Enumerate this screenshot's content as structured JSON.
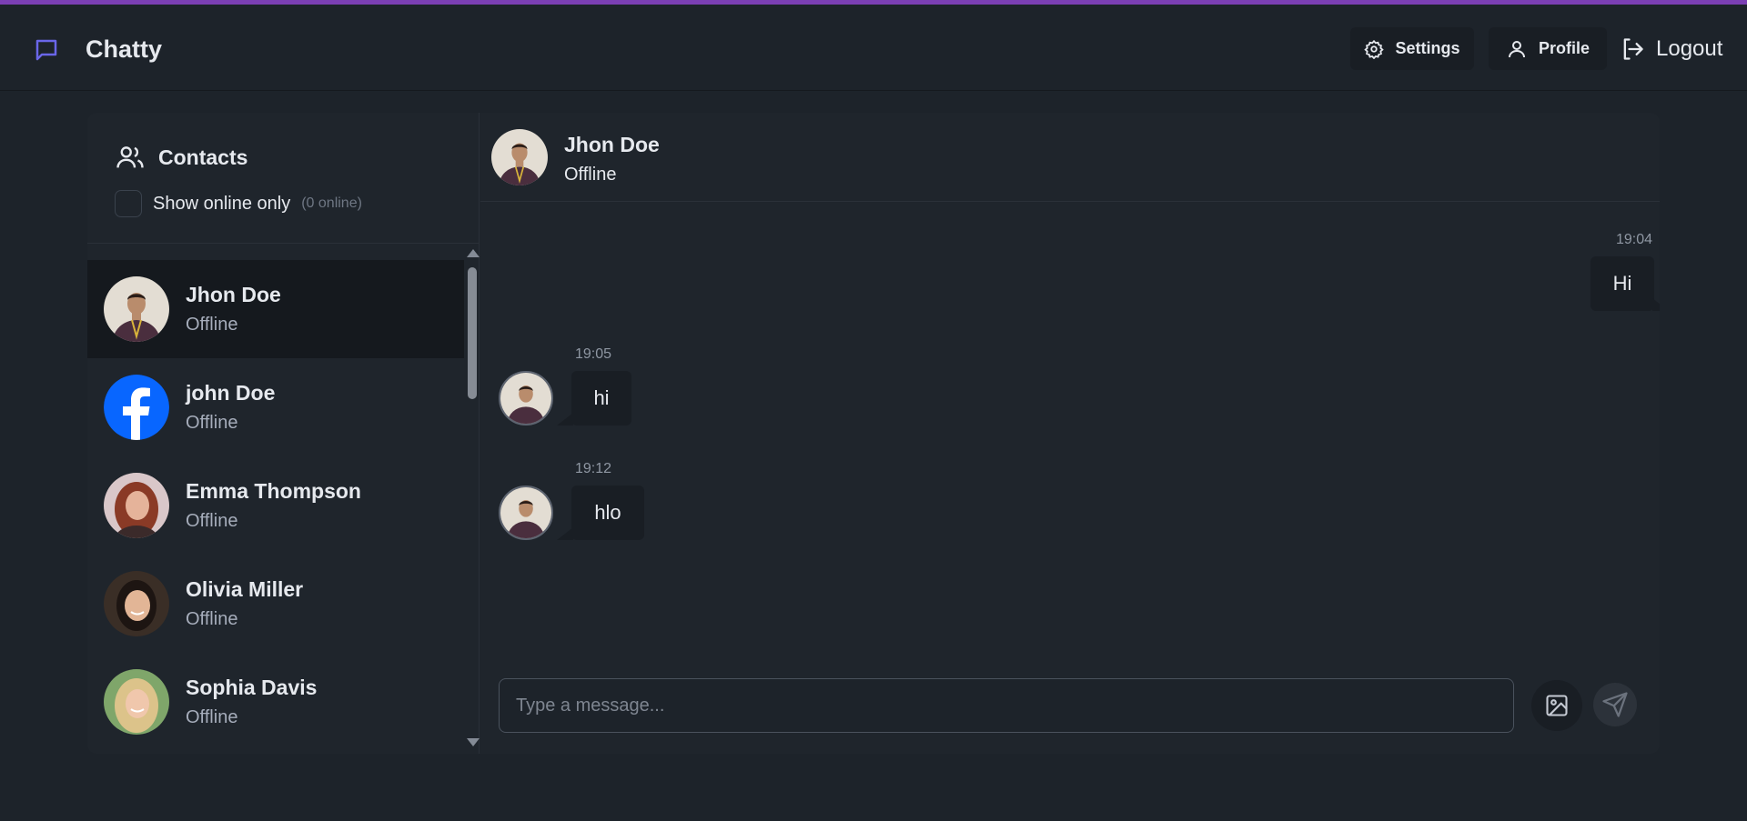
{
  "app": {
    "title": "Chatty",
    "accent": "#7b3fb4",
    "logo_color": "#6a66e8"
  },
  "header": {
    "settings_label": "Settings",
    "profile_label": "Profile",
    "logout_label": "Logout"
  },
  "sidebar": {
    "title": "Contacts",
    "filter_label": "Show online only",
    "online_count": "(0 online)",
    "contacts": [
      {
        "name": "Jhon Doe",
        "status": "Offline",
        "avatar": "man-lanyard-photo"
      },
      {
        "name": "john Doe",
        "status": "Offline",
        "avatar": "facebook-logo"
      },
      {
        "name": "Emma Thompson",
        "status": "Offline",
        "avatar": "woman-red-hair-photo"
      },
      {
        "name": "Olivia Miller",
        "status": "Offline",
        "avatar": "woman-dark-hair-photo"
      },
      {
        "name": "Sophia Davis",
        "status": "Offline",
        "avatar": "woman-blonde-photo"
      }
    ]
  },
  "chat": {
    "name": "Jhon Doe",
    "status": "Offline",
    "messages": [
      {
        "time": "19:04",
        "text": "Hi",
        "side": "right"
      },
      {
        "time": "19:05",
        "text": "hi",
        "side": "left"
      },
      {
        "time": "19:12",
        "text": "hlo",
        "side": "left"
      }
    ],
    "input_placeholder": "Type a message..."
  }
}
